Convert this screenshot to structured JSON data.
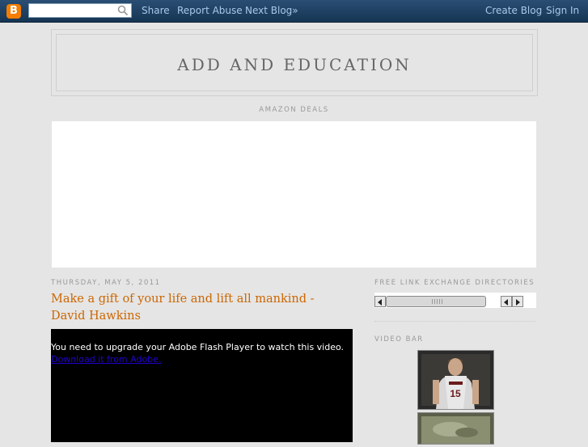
{
  "navbar": {
    "share": "Share",
    "report_abuse": "Report Abuse",
    "next_blog": "Next Blog»",
    "create_blog": "Create Blog",
    "sign_in": "Sign In",
    "search_placeholder": ""
  },
  "header": {
    "title": "ADD AND EDUCATION"
  },
  "amazon": {
    "label": "AMAZON DEALS"
  },
  "post": {
    "date": "THURSDAY, MAY 5, 2011",
    "title": "Make a gift of your life and lift all mankind -David Hawkins",
    "flash_message": "You need to upgrade your Adobe Flash Player to watch this video.",
    "flash_link": "Download it from Adobe."
  },
  "sidebar": {
    "link_exchange_heading": "FREE LINK EXCHANGE DIRECTORIES",
    "video_bar_heading": "VIDEO BAR",
    "video_bar_jersey_number": "15"
  },
  "colors": {
    "navbar": "#1a3a5c",
    "post_title": "#cc6600",
    "background": "#e5e5e5"
  }
}
